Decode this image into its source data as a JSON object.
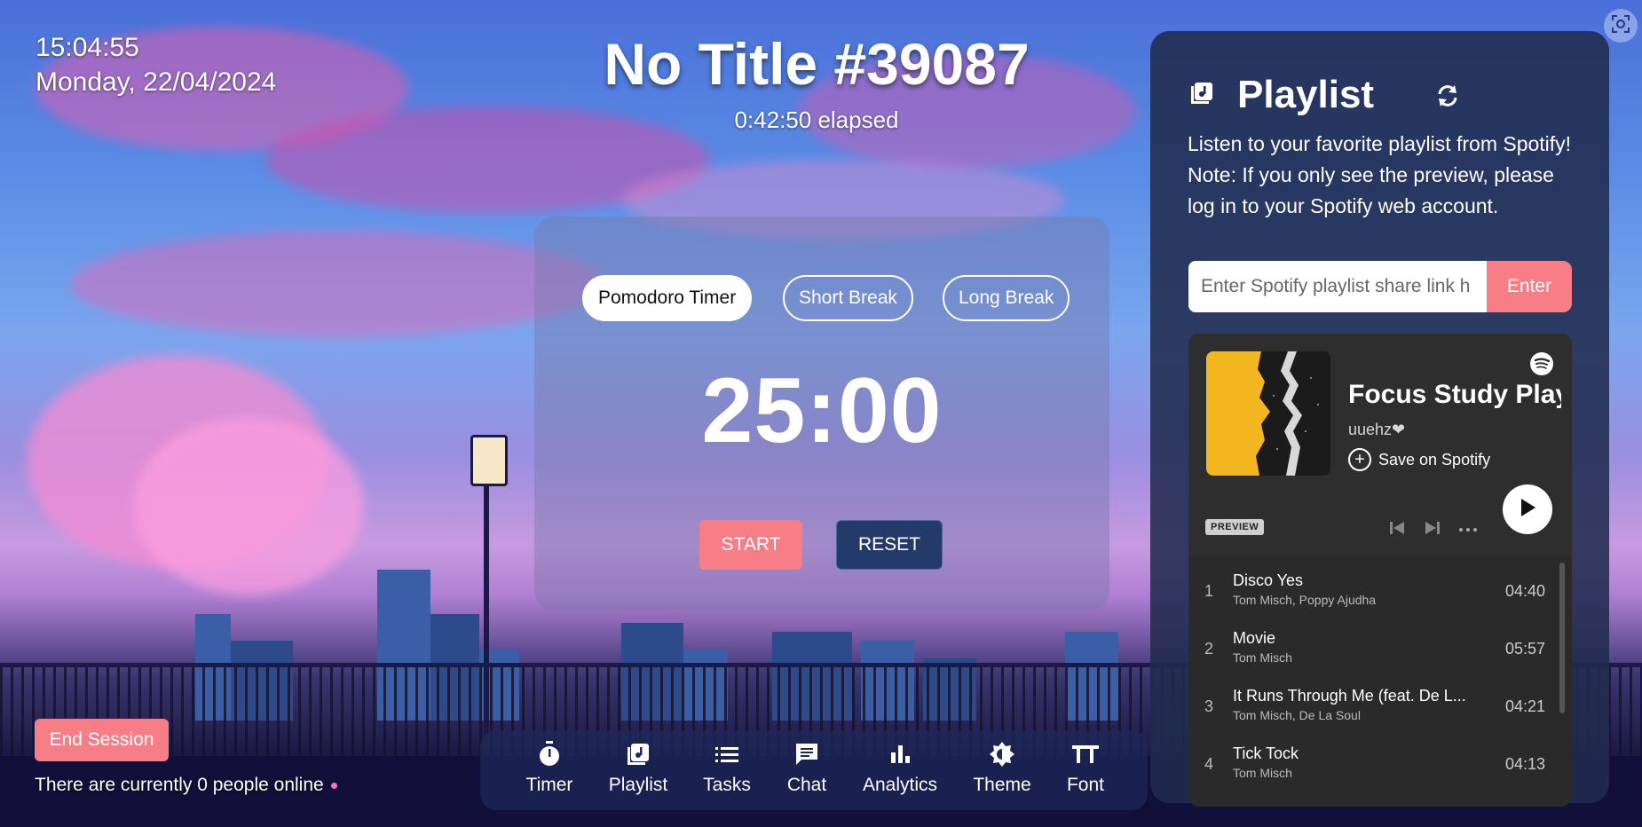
{
  "clock": {
    "time": "15:04:55",
    "date": "Monday, 22/04/2024"
  },
  "session": {
    "title": "No Title #39087",
    "elapsed": "0:42:50 elapsed"
  },
  "timer": {
    "modes": [
      {
        "label": "Pomodoro Timer",
        "active": true
      },
      {
        "label": "Short Break",
        "active": false
      },
      {
        "label": "Long Break",
        "active": false
      }
    ],
    "display": "25:00",
    "start_label": "START",
    "reset_label": "RESET"
  },
  "footer": {
    "end_session_label": "End Session",
    "online_text": "There are currently 0 people online"
  },
  "nav": {
    "items": [
      {
        "label": "Timer",
        "icon": "stopwatch-icon"
      },
      {
        "label": "Playlist",
        "icon": "music-library-icon"
      },
      {
        "label": "Tasks",
        "icon": "list-icon"
      },
      {
        "label": "Chat",
        "icon": "chat-icon"
      },
      {
        "label": "Analytics",
        "icon": "bar-chart-icon"
      },
      {
        "label": "Theme",
        "icon": "brightness-icon"
      },
      {
        "label": "Font",
        "icon": "text-size-icon"
      }
    ]
  },
  "playlist_panel": {
    "title": "Playlist",
    "desc_line1": "Listen to your favorite playlist from Spotify!",
    "desc_line2": "Note: If you only see the preview, please log in to your Spotify web account.",
    "input_placeholder": "Enter Spotify playlist share link h",
    "enter_label": "Enter"
  },
  "spotify_embed": {
    "playlist_name": "Focus Study Playl",
    "owner": "uuehz❤",
    "save_label": "Save on Spotify",
    "preview_label": "PREVIEW",
    "tracks": [
      {
        "num": "1",
        "name": "Disco Yes",
        "artist": "Tom Misch, Poppy Ajudha",
        "duration": "04:40"
      },
      {
        "num": "2",
        "name": "Movie",
        "artist": "Tom Misch",
        "duration": "05:57"
      },
      {
        "num": "3",
        "name": "It Runs Through Me (feat. De L...",
        "artist": "Tom Misch, De La Soul",
        "duration": "04:21"
      },
      {
        "num": "4",
        "name": "Tick Tock",
        "artist": "Tom Misch",
        "duration": "04:13"
      }
    ]
  },
  "colors": {
    "accent": "#f77e86",
    "navy": "#233a6a",
    "panel": "#212b4e",
    "spotify_dark": "#2a2a2a",
    "cover_yellow": "#f3b81f"
  }
}
